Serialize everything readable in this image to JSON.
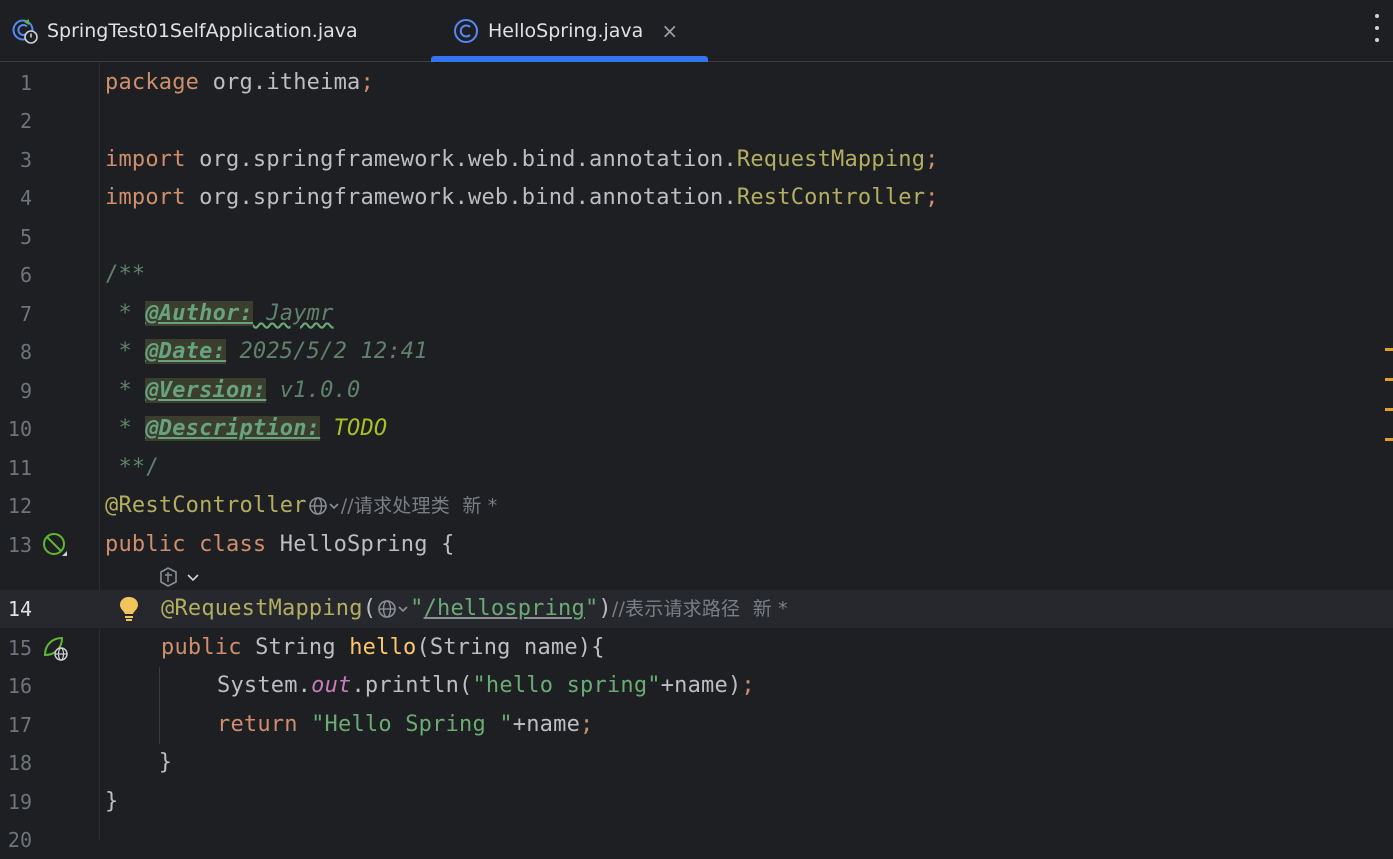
{
  "tabs": [
    {
      "label": "SpringTest01SelfApplication.java",
      "active": false
    },
    {
      "label": "HelloSpring.java",
      "active": true,
      "close": "×"
    }
  ],
  "inspections": {
    "warnings": "4",
    "ok": "2"
  },
  "lines": {
    "n1": "1",
    "n2": "2",
    "n3": "3",
    "n4": "4",
    "n5": "5",
    "n6": "6",
    "n7": "7",
    "n8": "8",
    "n9": "9",
    "n10": "10",
    "n11": "11",
    "n12": "12",
    "n13": "13",
    "n14": "14",
    "n15": "15",
    "n16": "16",
    "n17": "17",
    "n18": "18",
    "n19": "19",
    "n20": "20"
  },
  "code": {
    "l1_kw": "package",
    "l1_rest": " org.itheima",
    "l1_semi": ";",
    "l3_kw": "import",
    "l3_pkg": " org.springframework.web.bind.annotation.",
    "l3_cls": "RequestMapping",
    "l3_semi": ";",
    "l4_kw": "import",
    "l4_pkg": " org.springframework.web.bind.annotation.",
    "l4_cls": "RestController",
    "l4_semi": ";",
    "l6": "/**",
    "l7_star": " * ",
    "l7_tag": "@Author:",
    "l7_val": " Jaymr",
    "l8_star": " * ",
    "l8_tag": "@Date:",
    "l8_val": " 2025/5/2 12:41",
    "l9_star": " * ",
    "l9_tag": "@Version:",
    "l9_val": " v1.0.0",
    "l10_star": " * ",
    "l10_tag": "@Description:",
    "l10_val": " TODO",
    "l11": " **/",
    "l12_ann": "@RestController",
    "l12_cm": "//请求处理类",
    "l12_meta": "  新 *",
    "l13_kw1": "public",
    "l13_kw2": " class",
    "l13_rest": " HelloSpring {",
    "l14_ann": "@RequestMapping",
    "l14_p1": "(",
    "l14_q1": "\"",
    "l14_path": "/hellospring",
    "l14_q2": "\"",
    "l14_p2": ")",
    "l14_cm": "//表示请求路径",
    "l14_meta": "  新 *",
    "l15_kw": "public",
    "l15_type": " String ",
    "l15_fn": "hello",
    "l15_rest": "(String name){",
    "l16_a": "System.",
    "l16_out": "out",
    "l16_b": ".println(",
    "l16_str": "\"hello spring\"",
    "l16_c": "+name)",
    "l16_semi": ";",
    "l17_kw": "return",
    "l17_str": " \"Hello Spring \"",
    "l17_rest": "+name",
    "l17_semi": ";",
    "l18": "    }",
    "l19": "}"
  }
}
